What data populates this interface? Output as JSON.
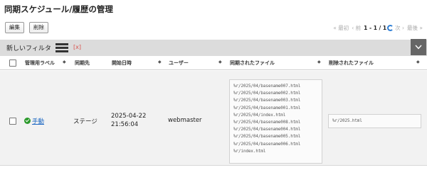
{
  "page": {
    "title": "同期スケジュール/履歴の管理"
  },
  "toolbar": {
    "edit_label": "編集",
    "delete_label": "削除"
  },
  "pager": {
    "first": "« 最初",
    "prev": "‹ 前",
    "range": "1 - 1 / 1",
    "next": "次 ›",
    "last": "最後 »"
  },
  "filter": {
    "label": "新しいフィルタ",
    "clear": "[x]"
  },
  "table": {
    "headers": {
      "label": "管理用ラベル",
      "destination": "同期先",
      "start": "開始日時",
      "user": "ユーザー",
      "synced": "同期されたファイル",
      "deleted": "削除されたファイル"
    },
    "rows": [
      {
        "label": "手動",
        "destination": "ステージ",
        "date": "2025-04-22",
        "time": "21:56:04",
        "user": "webmaster",
        "synced_files": [
          "%r/2025/04/basename007.html",
          "%r/2025/04/basename002.html",
          "%r/2025/04/basename003.html",
          "%r/2025/04/basename001.html",
          "%r/2025/04/index.html",
          "%r/2025/04/basename008.html",
          "%r/2025/04/basename004.html",
          "%r/2025/04/basename005.html",
          "%r/2025/04/basename006.html",
          "%r/index.html"
        ],
        "deleted_files": [
          "%r/2025.html"
        ]
      }
    ]
  },
  "colors": {
    "filter_bar": "#dcdcdc",
    "row_bg": "#f2f2f2",
    "link": "#1a66c2",
    "success": "#2c9a2c",
    "danger": "#d9534f",
    "refresh": "#2f7fd5"
  },
  "icons": [
    "list-icon",
    "chevron-down-icon",
    "refresh-icon",
    "check-circle-icon",
    "sort-icon"
  ]
}
